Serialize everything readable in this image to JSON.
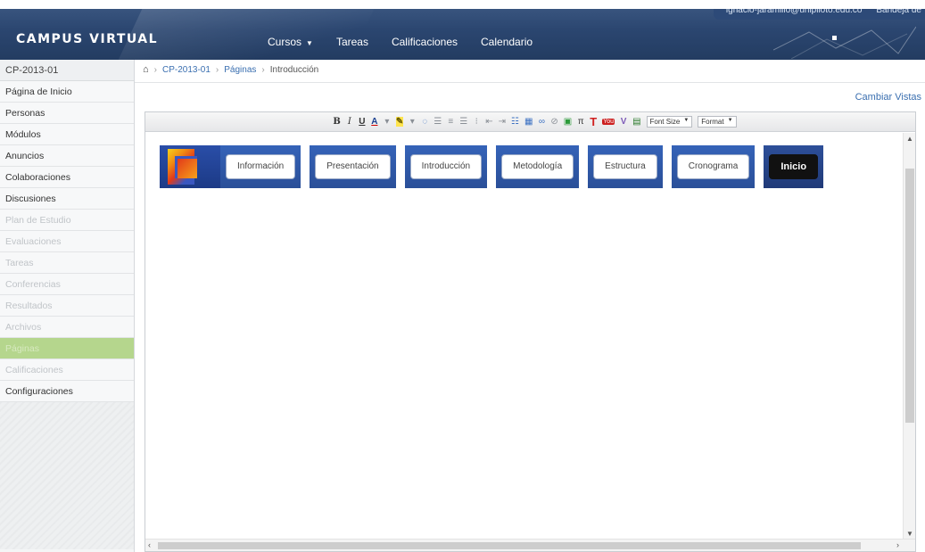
{
  "header": {
    "logo": "CAMPUS VIRTUAL",
    "nav": [
      {
        "label": "Cursos",
        "has_dropdown": true
      },
      {
        "label": "Tareas"
      },
      {
        "label": "Calificaciones"
      },
      {
        "label": "Calendario"
      }
    ],
    "user_email": "ignacio-jaramillo@unipiloto.edu.co",
    "inbox": "Bandeja de"
  },
  "sidebar": {
    "course_code": "CP-2013-01",
    "items": [
      {
        "label": "Página de Inicio",
        "state": "enabled"
      },
      {
        "label": "Personas",
        "state": "enabled"
      },
      {
        "label": "Módulos",
        "state": "enabled"
      },
      {
        "label": "Anuncios",
        "state": "enabled"
      },
      {
        "label": "Colaboraciones",
        "state": "enabled"
      },
      {
        "label": "Discusiones",
        "state": "enabled"
      },
      {
        "label": "Plan de Estudio",
        "state": "disabled"
      },
      {
        "label": "Evaluaciones",
        "state": "disabled"
      },
      {
        "label": "Tareas",
        "state": "disabled"
      },
      {
        "label": "Conferencias",
        "state": "disabled"
      },
      {
        "label": "Resultados",
        "state": "disabled"
      },
      {
        "label": "Archivos",
        "state": "disabled"
      },
      {
        "label": "Páginas",
        "state": "active"
      },
      {
        "label": "Calificaciones",
        "state": "disabled"
      },
      {
        "label": "Configuraciones",
        "state": "enabled"
      }
    ]
  },
  "breadcrumb": {
    "course": "CP-2013-01",
    "section": "Páginas",
    "current": "Introducción"
  },
  "cambiar_vistas": "Cambiar Vistas",
  "toolbar": {
    "bold": "B",
    "italic": "I",
    "underline": "U",
    "font_color": "A",
    "font_size": "Font Size",
    "format": "Format"
  },
  "course_nav": {
    "buttons": [
      "Información",
      "Presentación",
      "Introducción",
      "Metodología",
      "Estructura",
      "Cronograma",
      "Inicio"
    ]
  },
  "colors": {
    "header": "#2b4670",
    "active_sidebar": "#b5d68d",
    "link": "#3a6fb0",
    "banner_blue": "#2a4f98"
  }
}
